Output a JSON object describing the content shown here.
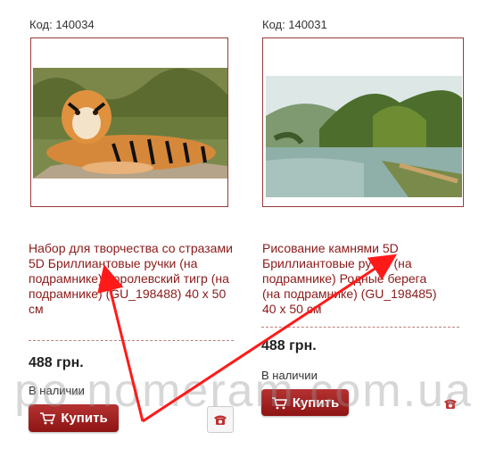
{
  "products": [
    {
      "code": "Код: 140034",
      "title": "Набор для творчества со стразами 5D Бриллиантовые ручки (на подрамнике) Королевский тигр (на подрамнике) (GU_198488) 40 x 50 см",
      "price": "488 грн.",
      "stock": "В наличии",
      "buy_label": "Купить",
      "image": "tiger-painting"
    },
    {
      "code": "Код: 140031",
      "title": "Рисование камнями 5D Бриллиантовые ручки (на подрамнике) Родные берега (на подрамнике) (GU_198485) 40 x 50 см",
      "price": "488 грн.",
      "stock": "В наличии",
      "buy_label": "Купить",
      "image": "landscape-painting"
    }
  ],
  "watermark": "po-nomeram.com.ua",
  "icons": {
    "cart": "cart-icon",
    "phone": "phone-icon"
  },
  "colors": {
    "accent": "#8b1a1a",
    "button": "#a52222",
    "arrow": "#ff1a1a"
  }
}
